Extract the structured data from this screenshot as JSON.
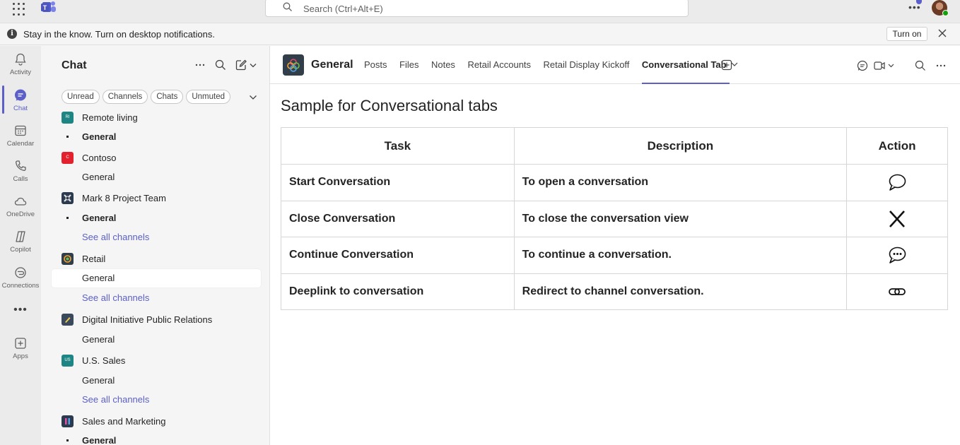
{
  "topbar": {
    "search_placeholder": "Search (Ctrl+Alt+E)",
    "more_label": "•••"
  },
  "notification": {
    "message": "Stay in the know. Turn on desktop notifications.",
    "turn_on_label": "Turn on"
  },
  "rail": {
    "items": [
      {
        "label": "Activity",
        "icon": "bell-icon"
      },
      {
        "label": "Chat",
        "icon": "chat-icon"
      },
      {
        "label": "Calendar",
        "icon": "calendar-icon"
      },
      {
        "label": "Calls",
        "icon": "phone-icon"
      },
      {
        "label": "OneDrive",
        "icon": "cloud-icon"
      },
      {
        "label": "Copilot",
        "icon": "copilot-icon"
      },
      {
        "label": "Connections",
        "icon": "connections-icon"
      },
      {
        "label": "Apps",
        "icon": "apps-plus-icon"
      }
    ],
    "more_label": "•••",
    "accent": "#5b5fc7"
  },
  "chat_pane": {
    "title": "Chat",
    "filters": [
      "Unread",
      "Channels",
      "Chats",
      "Unmuted"
    ]
  },
  "teams": [
    {
      "name": "Remote living",
      "avatar_text": "RI",
      "color": "#1d8583",
      "channels": [
        {
          "name": "General",
          "style": "bold"
        }
      ]
    },
    {
      "name": "Contoso",
      "avatar_text": "C",
      "color": "#e3202e",
      "channels": [
        {
          "name": "General",
          "style": "normal"
        }
      ]
    },
    {
      "name": "Mark 8 Project Team",
      "avatar_text": "",
      "color": "#2b3a4e",
      "channels": [
        {
          "name": "General",
          "style": "bold"
        },
        {
          "name": "See all channels",
          "style": "link"
        }
      ]
    },
    {
      "name": "Retail",
      "avatar_text": "",
      "color": "#323f4b",
      "channels": [
        {
          "name": "General",
          "style": "selected"
        },
        {
          "name": "See all channels",
          "style": "link"
        }
      ]
    },
    {
      "name": "Digital Initiative Public Relations",
      "avatar_text": "",
      "color": "#3a4a5c",
      "channels": [
        {
          "name": "General",
          "style": "normal"
        }
      ]
    },
    {
      "name": "U.S. Sales",
      "avatar_text": "US",
      "color": "#1d8583",
      "channels": [
        {
          "name": "General",
          "style": "normal"
        },
        {
          "name": "See all channels",
          "style": "link"
        }
      ]
    },
    {
      "name": "Sales and Marketing",
      "avatar_text": "",
      "color": "#2b3a4e",
      "channels": [
        {
          "name": "General",
          "style": "bold"
        }
      ]
    }
  ],
  "main": {
    "channel_name": "General",
    "tabs": [
      "Posts",
      "Files",
      "Notes",
      "Retail Accounts",
      "Retail Display Kickoff",
      "Conversational Tab"
    ],
    "active_tab": "Conversational Tab",
    "page_title": "Sample for Conversational tabs",
    "table": {
      "headers": [
        "Task",
        "Description",
        "Action"
      ],
      "rows": [
        {
          "task": "Start Conversation",
          "description": "To open a conversation",
          "action_icon": "speech-bubble-icon"
        },
        {
          "task": "Close Conversation",
          "description": "To close the conversation view",
          "action_icon": "close-x-icon"
        },
        {
          "task": "Continue Conversation",
          "description": "To continue a conversation.",
          "action_icon": "speech-bubble-dots-icon"
        },
        {
          "task": "Deeplink to conversation",
          "description": "Redirect to channel conversation.",
          "action_icon": "link-icon"
        }
      ]
    }
  }
}
